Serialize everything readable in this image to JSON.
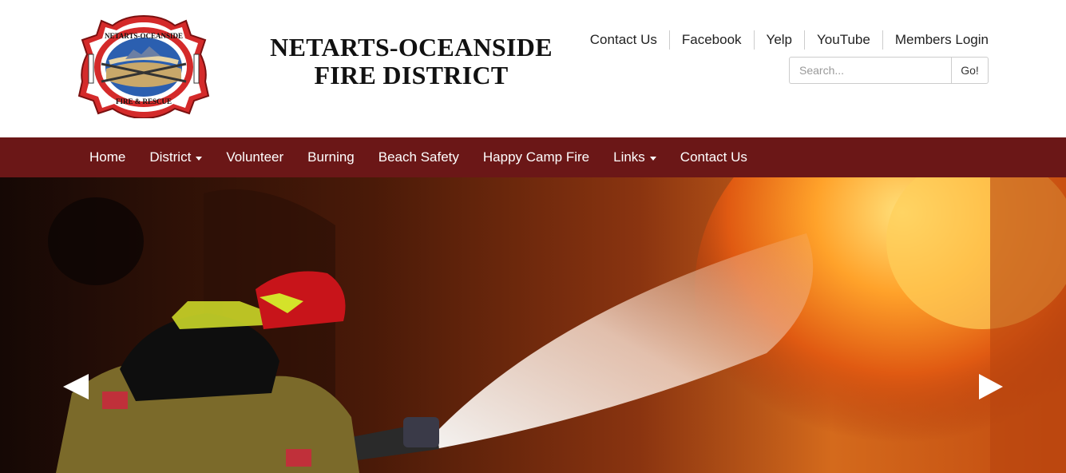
{
  "site": {
    "title_line1": "NETARTS-OCEANSIDE",
    "title_line2": "FIRE DISTRICT",
    "logo_text_top": "NETARTS-OCEANSIDE",
    "logo_text_bottom": "FIRE & RESCUE"
  },
  "top_links": [
    {
      "label": "Contact Us"
    },
    {
      "label": "Facebook"
    },
    {
      "label": "Yelp"
    },
    {
      "label": "YouTube"
    },
    {
      "label": "Members Login"
    }
  ],
  "search": {
    "placeholder": "Search...",
    "button_label": "Go!"
  },
  "nav": {
    "items": [
      {
        "label": "Home"
      },
      {
        "label": "District"
      },
      {
        "label": "Volunteer"
      },
      {
        "label": "Burning"
      },
      {
        "label": "Beach Safety"
      },
      {
        "label": "Happy Camp Fire"
      },
      {
        "label": "Links"
      },
      {
        "label": "Contact Us"
      }
    ]
  },
  "colors": {
    "nav_background": "#6b1717",
    "logo_red": "#d42a2a",
    "logo_blue": "#2b5fb0"
  },
  "icons": {
    "carousel_prev": "left-triangle-arrow",
    "carousel_next": "right-triangle-arrow"
  }
}
